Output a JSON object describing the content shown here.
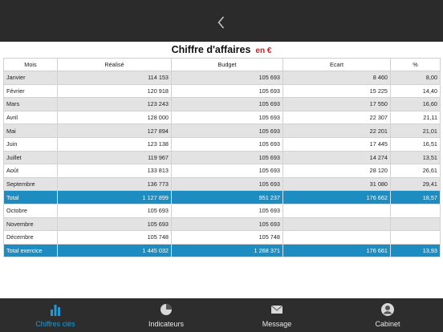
{
  "header": {
    "title": "Chiffre d'affaires",
    "unit": "en €"
  },
  "table": {
    "columns": [
      "Mois",
      "Réalisé",
      "Budget",
      "Ecart",
      "%"
    ],
    "rows": [
      {
        "cells": [
          "Janvier",
          "114 153",
          "105 693",
          "8 460",
          "8,00"
        ],
        "style": "odd"
      },
      {
        "cells": [
          "Février",
          "120 918",
          "105 693",
          "15 225",
          "14,40"
        ],
        "style": "even"
      },
      {
        "cells": [
          "Mars",
          "123 243",
          "105 693",
          "17 550",
          "16,60"
        ],
        "style": "odd"
      },
      {
        "cells": [
          "Avril",
          "128 000",
          "105 693",
          "22 307",
          "21,11"
        ],
        "style": "even"
      },
      {
        "cells": [
          "Mai",
          "127 894",
          "105 693",
          "22 201",
          "21,01"
        ],
        "style": "odd"
      },
      {
        "cells": [
          "Juin",
          "123 138",
          "105 693",
          "17 445",
          "16,51"
        ],
        "style": "even"
      },
      {
        "cells": [
          "Juillet",
          "119 967",
          "105 693",
          "14 274",
          "13,51"
        ],
        "style": "odd"
      },
      {
        "cells": [
          "Août",
          "133 813",
          "105 693",
          "28 120",
          "26,61"
        ],
        "style": "even"
      },
      {
        "cells": [
          "Septembre",
          "136 773",
          "105 693",
          "31 080",
          "29,41"
        ],
        "style": "odd"
      },
      {
        "cells": [
          "Total",
          "1 127 899",
          "951 237",
          "176 662",
          "18,57"
        ],
        "style": "total"
      },
      {
        "cells": [
          "Octobre",
          "105 693",
          "105 693",
          "",
          ""
        ],
        "style": "even"
      },
      {
        "cells": [
          "Novembre",
          "105 693",
          "105 693",
          "",
          ""
        ],
        "style": "odd"
      },
      {
        "cells": [
          "Décembre",
          "105 748",
          "105 748",
          "",
          ""
        ],
        "style": "even"
      },
      {
        "cells": [
          "Total exercice",
          "1 445 032",
          "1 268 371",
          "176 661",
          "13,93"
        ],
        "style": "total"
      }
    ]
  },
  "tabbar": {
    "tabs": [
      {
        "label": "Chiffres clés",
        "icon": "bar-chart-icon",
        "active": true
      },
      {
        "label": "Indicateurs",
        "icon": "pie-chart-icon",
        "active": false
      },
      {
        "label": "Message",
        "icon": "envelope-icon",
        "active": false
      },
      {
        "label": "Cabinet",
        "icon": "person-icon",
        "active": false
      }
    ]
  },
  "colors": {
    "accent": "#1d8cc0",
    "active_tab": "#1e9bd7",
    "unit": "#e0141a",
    "bar_bg": "#2b2b2b"
  }
}
